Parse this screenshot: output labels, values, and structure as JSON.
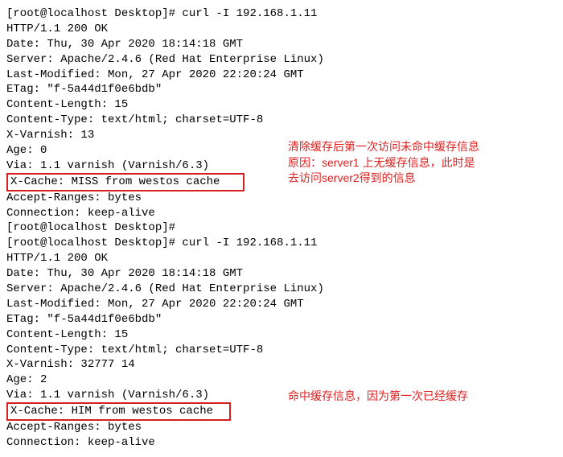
{
  "lines": {
    "l00": "[root@localhost Desktop]# curl -I 192.168.1.11",
    "l01": "HTTP/1.1 200 OK",
    "l02": "Date: Thu, 30 Apr 2020 18:14:18 GMT",
    "l03": "Server: Apache/2.4.6 (Red Hat Enterprise Linux)",
    "l04": "Last-Modified: Mon, 27 Apr 2020 22:20:24 GMT",
    "l05": "ETag: \"f-5a44d1f0e6bdb\"",
    "l06": "Content-Length: 15",
    "l07": "Content-Type: text/html; charset=UTF-8",
    "l08": "X-Varnish: 13",
    "l09": "Age: 0",
    "l10": "Via: 1.1 varnish (Varnish/6.3)",
    "l11": "X-Cache: MISS from westos cache   ",
    "l12": "Accept-Ranges: bytes",
    "l13": "Connection: keep-alive",
    "l14": "",
    "l15": "[root@localhost Desktop]#",
    "l16": "[root@localhost Desktop]# curl -I 192.168.1.11",
    "l17": "HTTP/1.1 200 OK",
    "l18": "Date: Thu, 30 Apr 2020 18:14:18 GMT",
    "l19": "Server: Apache/2.4.6 (Red Hat Enterprise Linux)",
    "l20": "Last-Modified: Mon, 27 Apr 2020 22:20:24 GMT",
    "l21": "ETag: \"f-5a44d1f0e6bdb\"",
    "l22": "Content-Length: 15",
    "l23": "Content-Type: text/html; charset=UTF-8",
    "l24": "X-Varnish: 32777 14",
    "l25": "Age: 2",
    "l26": "Via: 1.1 varnish (Varnish/6.3)",
    "l27": "X-Cache: HIM from westos cache  ",
    "l28": "Accept-Ranges: bytes",
    "l29": "Connection: keep-alive"
  },
  "annotations": {
    "a1l1": "清除缓存后第一次访问未命中缓存信息",
    "a1l2": "原因：server1 上无缓存信息，此时是",
    "a1l3": "去访问server2得到的信息",
    "a2": "命中缓存信息，因为第一次已经缓存"
  }
}
